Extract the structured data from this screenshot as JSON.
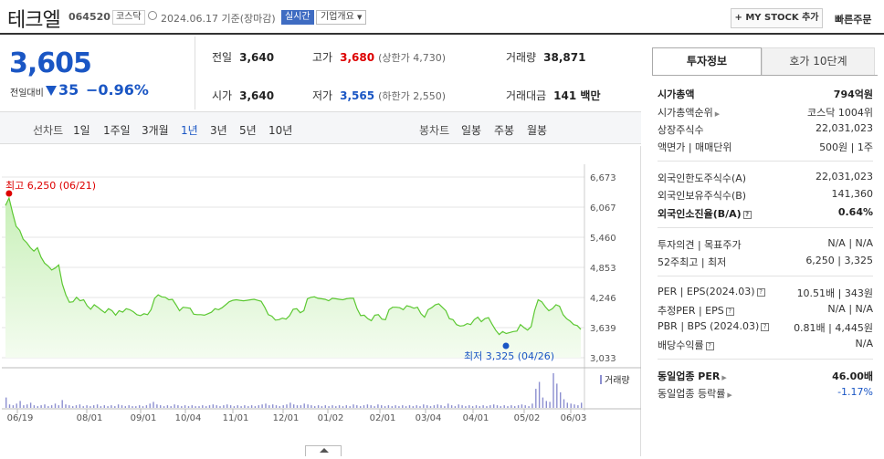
{
  "header": {
    "name": "테크엘",
    "code": "064520",
    "market": "코스닥",
    "date": "2024.06.17 기준(장마감)",
    "realtime": "실시간",
    "corp_overview": "기업개요",
    "mystock": "+ MY STOCK 추가",
    "quick_order": "빠른주문"
  },
  "price": {
    "current": "3,605",
    "diff_label": "전일대비",
    "diff": "35",
    "diff_pct": "−0.96%"
  },
  "stats": {
    "prev_label": "전일",
    "prev": "3,640",
    "high_label": "고가",
    "high": "3,680",
    "upper_limit": "(상한가 4,730)",
    "volume_label": "거래량",
    "volume": "38,871",
    "open_label": "시가",
    "open": "3,640",
    "low_label": "저가",
    "low": "3,565",
    "lower_limit": "(하한가 2,550)",
    "amount_label": "거래대금",
    "amount": "141 백만"
  },
  "periods": {
    "line_label": "선차트",
    "line_options": [
      "1일",
      "1주일",
      "3개월",
      "1년",
      "3년",
      "5년",
      "10년"
    ],
    "active": "1년",
    "candle_label": "봉차트",
    "candle_options": [
      "일봉",
      "주봉",
      "월봉"
    ]
  },
  "chart_data": {
    "type": "area",
    "y_ticks": [
      "6,673",
      "6,067",
      "5,460",
      "4,853",
      "4,246",
      "3,639",
      "3,033"
    ],
    "ylim": [
      3033,
      6673
    ],
    "x_ticks": [
      "06/19",
      "08/01",
      "09/01",
      "10/04",
      "11/01",
      "12/01",
      "01/02",
      "02/01",
      "03/04",
      "04/01",
      "05/02",
      "06/03"
    ],
    "high_label": "최고 6,250 (06/21)",
    "low_label": "최저 3,325 (04/26)",
    "volume_label": "거래량",
    "series": [
      {
        "values": [
          6100,
          6250,
          5950,
          5680,
          5600,
          5420,
          5350,
          5250,
          5180,
          5250,
          5060,
          4940,
          4880,
          4800,
          4840,
          4900,
          4520,
          4300,
          4150,
          4160,
          4250,
          4180,
          4200,
          4080,
          4010,
          4100,
          4050,
          3990,
          3940,
          4020,
          3980,
          3890,
          3980,
          3950,
          4020,
          4000,
          3960,
          3900,
          3880,
          3920,
          3900,
          4000,
          4230,
          4300,
          4260,
          4250,
          4200,
          4210,
          4100,
          3980,
          4050,
          4040,
          4030,
          3910,
          3900,
          3900,
          3890,
          3920,
          3950,
          4020,
          4000,
          4040,
          4100,
          4160,
          4190,
          4200,
          4190,
          4180,
          4190,
          4200,
          4210,
          4190,
          4170,
          4050,
          3900,
          3870,
          3790,
          3800,
          3830,
          3810,
          3880,
          4010,
          4020,
          3940,
          3980,
          4220,
          4250,
          4260,
          4230,
          4220,
          4210,
          4180,
          4230,
          4220,
          4210,
          4200,
          4220,
          4230,
          4230,
          4020,
          3880,
          3890,
          3820,
          3780,
          3890,
          3900,
          3810,
          3800,
          4000,
          4050,
          4050,
          4040,
          4000,
          4080,
          4060,
          4030,
          4050,
          3920,
          3850,
          4000,
          4040,
          4100,
          4120,
          4050,
          3980,
          3820,
          3800,
          3700,
          3670,
          3680,
          3720,
          3700,
          3800,
          3850,
          3760,
          3820,
          3840,
          3710,
          3590,
          3500,
          3560,
          3520,
          3540,
          3560,
          3570,
          3700,
          3640,
          3590,
          3660,
          3980,
          4200,
          4160,
          4060,
          3980,
          4020,
          4100,
          4070,
          3900,
          3820,
          3770,
          3700,
          3680,
          3605
        ]
      }
    ],
    "volume_values": [
      12,
      4,
      3,
      5,
      8,
      3,
      4,
      6,
      3,
      2,
      3,
      4,
      2,
      3,
      5,
      3,
      9,
      4,
      3,
      2,
      3,
      4,
      2,
      3,
      2,
      3,
      4,
      2,
      3,
      2,
      3,
      2,
      4,
      3,
      2,
      3,
      2,
      2,
      3,
      2,
      3,
      5,
      7,
      4,
      3,
      2,
      3,
      2,
      4,
      3,
      2,
      3,
      2,
      3,
      2,
      2,
      3,
      2,
      3,
      4,
      3,
      2,
      3,
      4,
      3,
      2,
      3,
      2,
      3,
      2,
      3,
      2,
      3,
      4,
      5,
      3,
      4,
      3,
      2,
      3,
      4,
      6,
      4,
      3,
      3,
      5,
      4,
      3,
      2,
      3,
      2,
      3,
      2,
      3,
      2,
      3,
      2,
      3,
      2,
      4,
      3,
      2,
      3,
      4,
      3,
      2,
      4,
      3,
      2,
      3,
      2,
      3,
      2,
      3,
      2,
      3,
      2,
      3,
      2,
      4,
      3,
      2,
      3,
      4,
      3,
      2,
      5,
      3,
      2,
      4,
      3,
      2,
      3,
      2,
      3,
      2,
      3,
      2,
      3,
      4,
      3,
      2,
      3,
      2,
      3,
      2,
      3,
      4,
      3,
      2,
      5,
      22,
      30,
      12,
      8,
      7,
      40,
      28,
      18,
      10,
      6,
      5,
      4,
      3,
      6
    ]
  },
  "side": {
    "tab_invest": "투자정보",
    "tab_hoga": "호가 10단계",
    "rows": [
      {
        "l": "시가총액",
        "r": "794억원",
        "bold": true
      },
      {
        "l": "시가총액순위",
        "r": "코스닥 1004위"
      },
      {
        "l": "상장주식수",
        "r": "22,031,023"
      },
      {
        "l": "액면가 | 매매단위",
        "r": "500원 | 1주"
      },
      {
        "l": "외국인한도주식수(A)",
        "r": "22,031,023"
      },
      {
        "l": "외국인보유주식수(B)",
        "r": "141,360"
      },
      {
        "l": "외국인소진율(B/A)",
        "r": "0.64%",
        "bold": true
      },
      {
        "l": "투자의견 | 목표주가",
        "r": "N/A | N/A"
      },
      {
        "l": "52주최고 | 최저",
        "r": "6,250 | 3,325"
      },
      {
        "l": "PER | EPS(2024.03)",
        "r": "10.51배 | 343원"
      },
      {
        "l": "추정PER | EPS",
        "r": "N/A | N/A"
      },
      {
        "l": "PBR | BPS (2024.03)",
        "r": "0.81배 | 4,445원"
      },
      {
        "l": "배당수익률",
        "r": "N/A"
      },
      {
        "l": "동일업종 PER",
        "r": "46.00배",
        "bold": true
      },
      {
        "l": "동일업종 등락률",
        "r": "-1.17%",
        "blue": true
      }
    ]
  }
}
